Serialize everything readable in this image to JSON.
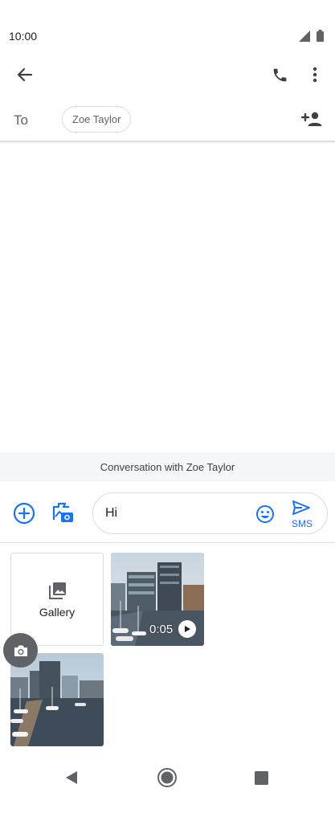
{
  "status_bar": {
    "time": "10:00"
  },
  "app_bar": {
    "back_icon": "arrow-left-icon",
    "call_icon": "phone-icon",
    "menu_icon": "more-vert-icon"
  },
  "recipients": {
    "to_label": "To",
    "chips": [
      "Zoe Taylor"
    ],
    "add_icon": "add-person-icon"
  },
  "conversation": {
    "banner": "Conversation with Zoe Taylor"
  },
  "compose": {
    "text": "Hi",
    "send_label": "SMS",
    "accent": "#1a73e8"
  },
  "media_picker": {
    "gallery_label": "Gallery",
    "video_duration": "0:05"
  }
}
